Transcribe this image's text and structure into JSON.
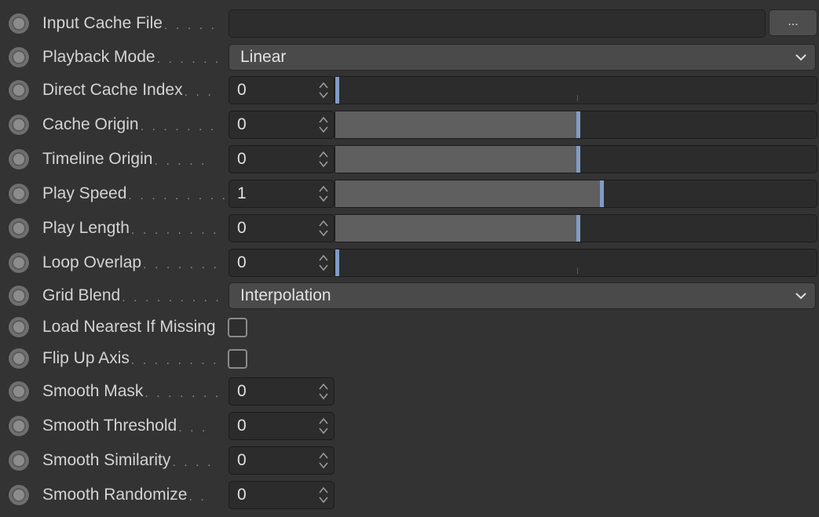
{
  "params": [
    {
      "id": "input_cache_file",
      "label": "Input Cache File",
      "dots": ". . . . .",
      "type": "file",
      "value": "",
      "browse_label": "..."
    },
    {
      "id": "playback_mode",
      "label": "Playback Mode",
      "dots": ". . . . . .",
      "type": "dropdown",
      "value": "Linear"
    },
    {
      "id": "direct_cache_index",
      "label": "Direct Cache Index",
      "dots": ". . .",
      "type": "slider",
      "value": "0",
      "slider_fraction": 0.0
    },
    {
      "id": "cache_origin",
      "label": "Cache Origin",
      "dots": ". . . . . . .",
      "type": "slider",
      "value": "0",
      "slider_fraction": 0.5
    },
    {
      "id": "timeline_origin",
      "label": "Timeline Origin",
      "dots": ". . . . .",
      "type": "slider",
      "value": "0",
      "slider_fraction": 0.5
    },
    {
      "id": "play_speed",
      "label": "Play Speed",
      "dots": ". . . . . . . . .",
      "type": "slider",
      "value": "1",
      "slider_fraction": 0.55
    },
    {
      "id": "play_length",
      "label": "Play Length",
      "dots": ". . . . . . . .",
      "type": "slider",
      "value": "0",
      "slider_fraction": 0.5
    },
    {
      "id": "loop_overlap",
      "label": "Loop Overlap",
      "dots": ". . . . . . .",
      "type": "slider",
      "value": "0",
      "slider_fraction": 0.0
    },
    {
      "id": "grid_blend",
      "label": "Grid Blend",
      "dots": ". . . . . . . . . .",
      "type": "dropdown",
      "value": "Interpolation"
    },
    {
      "id": "load_nearest_if_missing",
      "label": "Load Nearest If Missing",
      "dots": "",
      "type": "checkbox",
      "checked": false
    },
    {
      "id": "flip_up_axis",
      "label": "Flip Up Axis",
      "dots": ". . . . . . . . .",
      "type": "checkbox",
      "checked": false
    },
    {
      "id": "smooth_mask",
      "label": "Smooth Mask",
      "dots": ". . . . . . .",
      "type": "number",
      "value": "0"
    },
    {
      "id": "smooth_threshold",
      "label": "Smooth Threshold",
      "dots": ". . .",
      "type": "number",
      "value": "0"
    },
    {
      "id": "smooth_similarity",
      "label": "Smooth Similarity",
      "dots": ". . . .",
      "type": "number",
      "value": "0"
    },
    {
      "id": "smooth_randomize",
      "label": "Smooth Randomize",
      "dots": ". .",
      "type": "number",
      "value": "0"
    }
  ],
  "colors": {
    "background": "#333333",
    "slider_handle": "#7f9cc8",
    "slider_fill": "#5f5f5f",
    "dropdown_bg": "#4a4a4a"
  }
}
